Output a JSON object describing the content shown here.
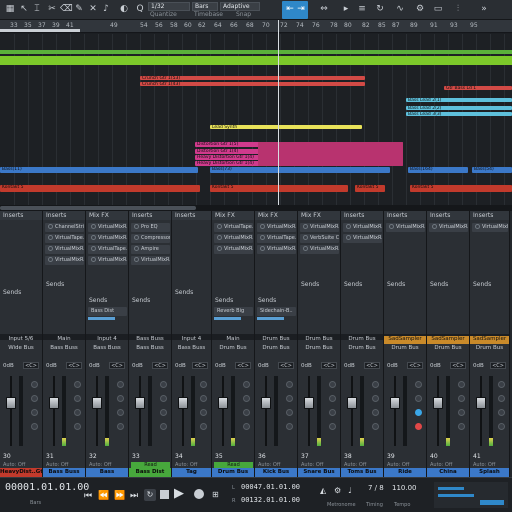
{
  "toolbar": {
    "quantize_value": "1/32",
    "quantize_label": "Quantize",
    "timebase_value": "Bars",
    "timebase_label": "Timebase",
    "snap_value": "Adaptive",
    "snap_label": "Snap"
  },
  "ruler": {
    "bars": [
      "33",
      "35",
      "37",
      "39",
      "41",
      "49",
      "54",
      "56",
      "58",
      "60",
      "62",
      "64",
      "66",
      "68",
      "70",
      "72",
      "74",
      "76",
      "78",
      "80",
      "82",
      "85",
      "87",
      "89",
      "91",
      "93",
      "95"
    ]
  },
  "arrange": {
    "clips": [
      {
        "label": "Crunch Gtr 1(53)",
        "color": "#d24a46",
        "track": "crunch-1"
      },
      {
        "label": "Crunch Gtr 1(43)",
        "color": "#d24a46",
        "track": "crunch-2"
      },
      {
        "label": "Gtr Bass Ld 1",
        "color": "#d24a46",
        "track": "gtr-bass"
      },
      {
        "label": "Bass Lead 2(1)",
        "color": "#5ec0dc",
        "track": "bass-lead-1"
      },
      {
        "label": "Bass Lead 2(2)",
        "color": "#5ec0dc",
        "track": "bass-lead-2"
      },
      {
        "label": "Bass Lead 3(3)",
        "color": "#5ec0dc",
        "track": "bass-lead-3"
      },
      {
        "label": "Lead Synth",
        "color": "#e8e25a",
        "track": "lead"
      },
      {
        "label": "Distortion Gtr 1(5)",
        "color": "#d03a8c",
        "track": "dist-1"
      },
      {
        "label": "Distortion Gtr 1(4)",
        "color": "#d03a8c",
        "track": "dist-2"
      },
      {
        "label": "Heavy Distortion Gtr 1(4)",
        "color": "#d03a8c",
        "track": "dist-3"
      },
      {
        "label": "Heavy Distortion Gtr 1(4)",
        "color": "#d03a8c",
        "track": "dist-4"
      },
      {
        "label": "Bass(11)",
        "color": "#3b78c8",
        "track": "bass"
      },
      {
        "label": "Bass(73)",
        "color": "#3b78c8",
        "track": "bass"
      },
      {
        "label": "Bass(164)",
        "color": "#3b78c8",
        "track": "bass"
      },
      {
        "label": "Bass(54)",
        "color": "#3b78c8",
        "track": "bass"
      },
      {
        "label": "Kontakt 5",
        "color": "#c23a2c",
        "track": "kontakt"
      },
      {
        "label": "Kontakt 5",
        "color": "#c23a2c",
        "track": "kontakt"
      },
      {
        "label": "Kontakt 5",
        "color": "#c23a2c",
        "track": "kontakt"
      },
      {
        "label": "Kontakt 5",
        "color": "#c23a2c",
        "track": "kontakt"
      }
    ]
  },
  "mixer": {
    "inserts_label": "Inserts",
    "mixfx_label": "Mix FX",
    "sends_label": "Sends",
    "strips": [
      {
        "num": "30",
        "name": "HeavyDist..Gtr2",
        "io": "Input 5/6",
        "bus": "Wide Bus",
        "color": "#c23a2c",
        "auto": "Auto: Off",
        "inserts": [],
        "sends": []
      },
      {
        "num": "31",
        "name": "Bass Buss",
        "io": "Main",
        "bus": "Bass Buss",
        "color": "#3b78c8",
        "auto": "Auto: Off",
        "inserts": [
          "ChannelStrip",
          "VirtualTape..",
          "VirtualMixR..",
          "VirtualMixR.."
        ],
        "sends": []
      },
      {
        "num": "32",
        "name": "Bass",
        "io": "Input 4",
        "bus": "Bass Buss",
        "color": "#3b78c8",
        "auto": "Auto: Off",
        "inserts": [
          "VirtualMixR..",
          "VirtualMixR..",
          "VirtualTape..",
          "VirtualMixR.."
        ],
        "sends": [
          "Bass Dist"
        ]
      },
      {
        "num": "33",
        "name": "Bass Dist",
        "io": "Bass Buss",
        "bus": "Bass Buss",
        "color": "#47a83c",
        "auto": "Read",
        "inserts": [
          "Pro EQ",
          "Compressor",
          "Ampire",
          "VirtualMixR.."
        ],
        "sends": []
      },
      {
        "num": "34",
        "name": "Tag",
        "io": "Input 4",
        "bus": "Bass Buss",
        "color": "#3b78c8",
        "auto": "Auto: Off",
        "inserts": [],
        "sends": []
      },
      {
        "num": "35",
        "name": "Drum Bus",
        "io": "Main",
        "bus": "Drum Bus",
        "color": "#3b78c8",
        "auto": "Read",
        "inserts": [
          "VirtualTape..",
          "VirtualMixR..",
          "VirtualMixR.."
        ],
        "sends": [
          "Reverb Big"
        ]
      },
      {
        "num": "36",
        "name": "Kick Bus",
        "io": "Drum Bus",
        "bus": "Drum Bus",
        "color": "#3b78c8",
        "auto": "Auto: Off",
        "inserts": [
          "VirtualMixR..",
          "VirtualTape..",
          "VirtualMixR.."
        ],
        "sends": [
          "Sidechain-B.."
        ]
      },
      {
        "num": "37",
        "name": "Snare Bus",
        "io": "Drum Bus",
        "bus": "Drum Bus",
        "color": "#3b78c8",
        "auto": "Auto: Off",
        "inserts": [
          "VirtualMixR..",
          "VerbSuite Cl..",
          "VirtualMixR.."
        ],
        "sends": []
      },
      {
        "num": "38",
        "name": "Toms Bus",
        "io": "Drum Bus",
        "bus": "Drum Bus",
        "color": "#3b78c8",
        "auto": "Auto: Off",
        "inserts": [
          "VirtualMixR..",
          "VirtualMixR.."
        ],
        "sends": []
      },
      {
        "num": "39",
        "name": "Ride",
        "io": "SadSampler",
        "bus": "Drum Bus",
        "color": "#3b78c8",
        "auto": "Auto: Off",
        "inserts": [
          "VirtualMixR.."
        ],
        "sends": []
      },
      {
        "num": "40",
        "name": "China",
        "io": "SadSampler",
        "bus": "Drum Bus",
        "color": "#3b78c8",
        "auto": "Auto: Off",
        "inserts": [
          "VirtualMixR.."
        ],
        "sends": []
      },
      {
        "num": "41",
        "name": "Splash",
        "io": "SadSampler",
        "bus": "Drum Bus",
        "color": "#3b78c8",
        "auto": "Auto: Off",
        "inserts": [
          "VirtualMixR.."
        ],
        "sends": []
      }
    ],
    "vol_label": "0dB"
  },
  "transport": {
    "position": "00001.01.01.00",
    "position_unit": "Bars",
    "loop_start": "00047.01.01.00",
    "loop_end": "00132.01.01.00",
    "l_label": "L",
    "r_label": "R",
    "metronome_label": "Metronome",
    "timing_value": "7 / 8",
    "timing_label": "Timing",
    "tempo_value": "110.00",
    "tempo_label": "Tempo"
  },
  "colors": {
    "accent": "#2f88c9",
    "playhead": "#d8dde2",
    "meter_green": "#4fb040"
  }
}
